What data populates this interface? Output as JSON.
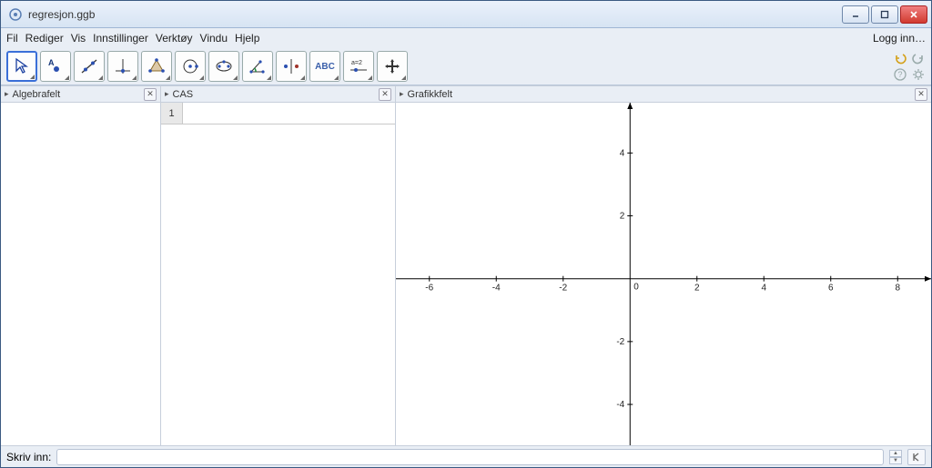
{
  "window": {
    "title": "regresjon.ggb"
  },
  "menubar": {
    "items": [
      "Fil",
      "Rediger",
      "Vis",
      "Innstillinger",
      "Verktøy",
      "Vindu",
      "Hjelp"
    ],
    "login": "Logg inn…"
  },
  "toolbar": {
    "tools": [
      {
        "name": "move-tool",
        "label": "Flytt",
        "selected": true
      },
      {
        "name": "point-tool",
        "label": "Nytt punkt"
      },
      {
        "name": "line-tool",
        "label": "Linje"
      },
      {
        "name": "perpendicular-tool",
        "label": "Normal"
      },
      {
        "name": "polygon-tool",
        "label": "Polygon"
      },
      {
        "name": "circle-tool",
        "label": "Sirkel"
      },
      {
        "name": "ellipse-tool",
        "label": "Kjeglesnitt"
      },
      {
        "name": "angle-tool",
        "label": "Vinkel"
      },
      {
        "name": "reflect-tool",
        "label": "Speil"
      },
      {
        "name": "text-tool",
        "label": "ABC"
      },
      {
        "name": "slider-tool",
        "label": "a=2"
      },
      {
        "name": "move-view-tool",
        "label": "Flytt grafikkfelt"
      }
    ]
  },
  "panels": {
    "algebra": {
      "title": "Algebrafelt"
    },
    "cas": {
      "title": "CAS",
      "row1_num": "1",
      "row1_value": ""
    },
    "graphics": {
      "title": "Grafikkfelt",
      "x_ticks": [
        -6,
        -4,
        -2,
        0,
        2,
        4,
        6,
        8
      ],
      "y_ticks": [
        -4,
        -2,
        0,
        2,
        4
      ]
    }
  },
  "inputbar": {
    "label": "Skriv inn:",
    "value": ""
  }
}
